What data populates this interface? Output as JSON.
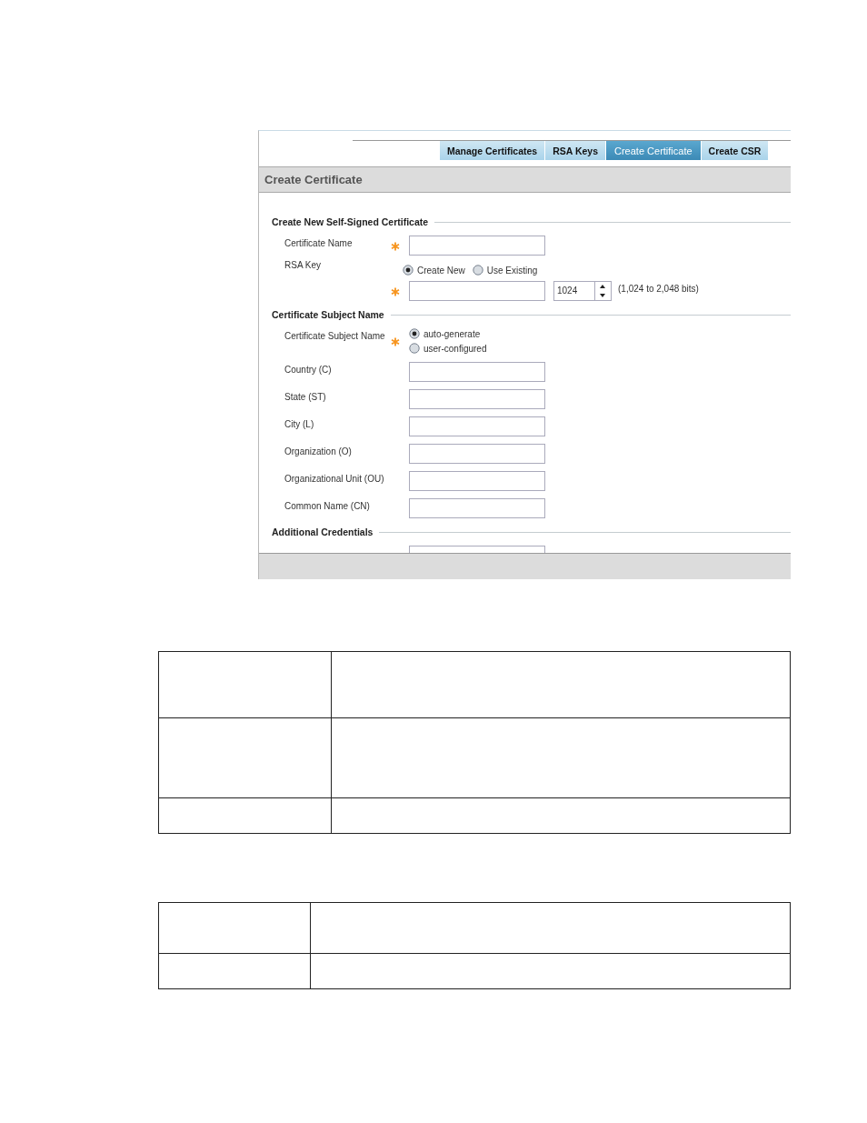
{
  "tabs": [
    {
      "label": "Manage Certificates",
      "selected": false
    },
    {
      "label": "RSA Keys",
      "selected": false
    },
    {
      "label": "Create Certificate",
      "selected": true
    },
    {
      "label": "Create CSR",
      "selected": false
    }
  ],
  "panel": {
    "title": "Create Certificate",
    "sections": [
      {
        "title": "Create New Self-Signed Certificate",
        "rows": [
          {
            "kind": "text",
            "label": "Certificate Name",
            "required": true
          },
          {
            "kind": "radio-inline",
            "label": "RSA Key",
            "options": [
              {
                "label": "Create New",
                "selected": true
              },
              {
                "label": "Use Existing",
                "selected": false
              }
            ]
          },
          {
            "kind": "spinner",
            "required": true,
            "value": "1024",
            "hint": "(1,024 to 2,048 bits)"
          }
        ]
      },
      {
        "title": "Certificate Subject Name",
        "rows": [
          {
            "kind": "radio-stack",
            "label": "Certificate Subject Name",
            "required": true,
            "options": [
              {
                "label": "auto-generate",
                "selected": true
              },
              {
                "label": "user-configured",
                "selected": false
              }
            ]
          },
          {
            "kind": "text",
            "label": "Country (C)",
            "required": false
          },
          {
            "kind": "text",
            "label": "State (ST)",
            "required": false
          },
          {
            "kind": "text",
            "label": "City (L)",
            "required": false
          },
          {
            "kind": "text",
            "label": "Organization (O)",
            "required": false
          },
          {
            "kind": "text",
            "label": "Organizational Unit (OU)",
            "required": false
          },
          {
            "kind": "text",
            "label": "Common Name (CN)",
            "required": false
          }
        ]
      },
      {
        "title": "Additional Credentials",
        "rows": [
          {
            "kind": "text-cut"
          }
        ]
      }
    ]
  },
  "tables": [
    {
      "kind": "wide",
      "rows": [
        {
          "kind": "medium"
        },
        {
          "kind": "tall"
        },
        {
          "kind": "short"
        }
      ]
    },
    {
      "kind": "narrow",
      "rows": [
        {
          "kind": "compact"
        },
        {
          "kind": "short"
        }
      ]
    }
  ]
}
